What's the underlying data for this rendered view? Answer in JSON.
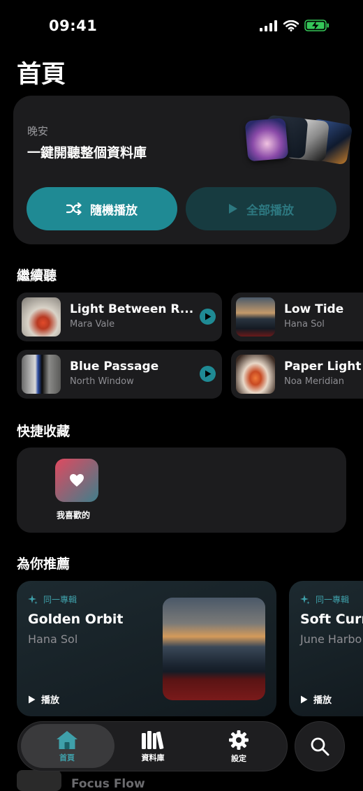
{
  "status": {
    "time": "09:41"
  },
  "page": {
    "title": "首頁"
  },
  "hero": {
    "greeting": "晚安",
    "subtitle": "一鍵開聽整個資料庫",
    "shuffle_label": "隨機播放",
    "play_all_label": "全部播放"
  },
  "continue": {
    "title": "繼續聽",
    "items": [
      {
        "title": "Light Between R...",
        "artist": "Mara Vale"
      },
      {
        "title": "Low Tide",
        "artist": "Hana Sol"
      },
      {
        "title": "Blue Passage",
        "artist": "North Window"
      },
      {
        "title": "Paper Light",
        "artist": "Noa Meridian"
      }
    ]
  },
  "favorites": {
    "title": "快捷收藏",
    "items": [
      {
        "label": "我喜歡的"
      }
    ]
  },
  "recommend": {
    "title": "為你推薦",
    "cards": [
      {
        "tag": "同一專輯",
        "title": "Golden Orbit",
        "artist": "Hana Sol",
        "play": "播放"
      },
      {
        "tag": "同一專輯",
        "title": "Soft Curre",
        "artist": "June Harbo",
        "play": "播放"
      }
    ]
  },
  "tabbar": {
    "tabs": [
      {
        "label": "首頁",
        "icon": "home-icon"
      },
      {
        "label": "資料庫",
        "icon": "library-icon"
      },
      {
        "label": "設定",
        "icon": "gear-icon"
      }
    ],
    "search_icon": "search-icon"
  },
  "peek": {
    "title": "Focus Flow"
  },
  "colors": {
    "accent": "#1f8a94",
    "background": "#000000",
    "card": "#1c1c1e"
  }
}
